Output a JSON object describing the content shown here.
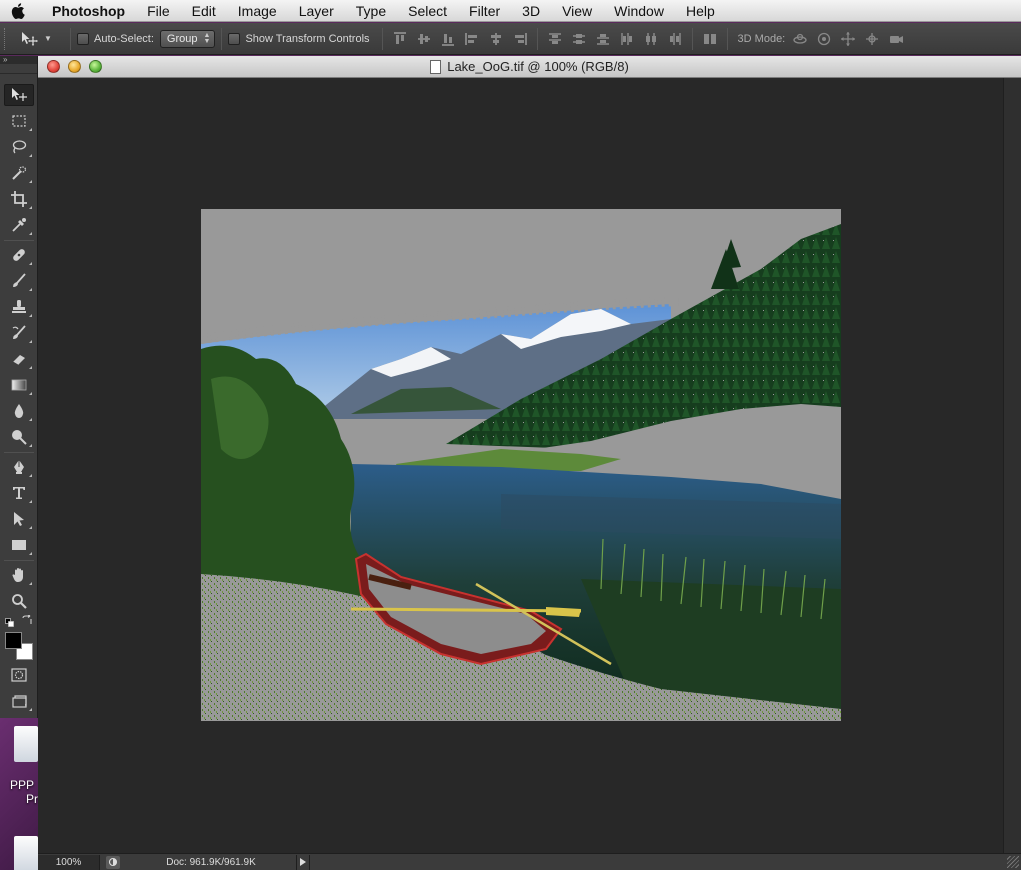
{
  "menubar": {
    "app_name": "Photoshop",
    "items": [
      "File",
      "Edit",
      "Image",
      "Layer",
      "Type",
      "Select",
      "Filter",
      "3D",
      "View",
      "Window",
      "Help"
    ]
  },
  "options": {
    "auto_select_label": "Auto-Select:",
    "auto_select_value": "Group",
    "show_transform_label": "Show Transform Controls",
    "mode_3d_label": "3D Mode:"
  },
  "document": {
    "title": "Lake_OoG.tif @ 100% (RGB/8)",
    "zoom": "100%",
    "doc_size": "Doc: 961.9K/961.9K"
  },
  "desktop": {
    "labels": [
      "PPP",
      "Pr"
    ]
  },
  "colors": {
    "foreground": "#000000",
    "background": "#ffffff",
    "gamut_warning": "#999999"
  },
  "tools": [
    "move",
    "rectangular-marquee",
    "lasso",
    "quick-selection",
    "crop",
    "eyedropper",
    "spot-healing",
    "brush",
    "clone-stamp",
    "history-brush",
    "eraser",
    "gradient",
    "blur",
    "dodge",
    "pen",
    "type",
    "path-selection",
    "rectangle",
    "hand",
    "zoom"
  ]
}
